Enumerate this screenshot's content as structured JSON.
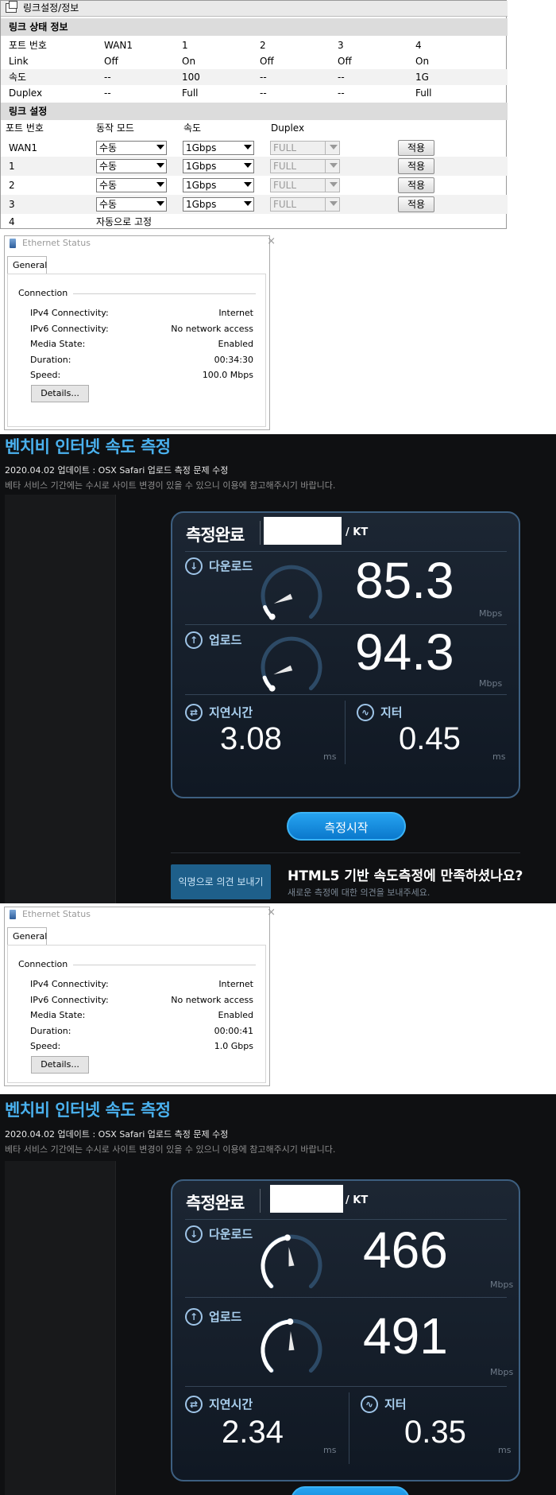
{
  "router": {
    "title": "링크설정/정보",
    "status_section": "링크 상태 정보",
    "status_header": [
      "포트 번호",
      "WAN1",
      "1",
      "2",
      "3",
      "4"
    ],
    "status_rows": [
      [
        "Link",
        "Off",
        "On",
        "Off",
        "Off",
        "On"
      ],
      [
        "속도",
        "--",
        "100",
        "--",
        "--",
        "1G"
      ],
      [
        "Duplex",
        "--",
        "Full",
        "--",
        "--",
        "Full"
      ]
    ],
    "settings_section": "링크 설정",
    "settings_header": [
      "포트 번호",
      "동작 모드",
      "속도",
      "Duplex"
    ],
    "settings_rows": [
      {
        "port": "WAN1",
        "mode": "수동",
        "speed": "1Gbps",
        "duplex": "FULL",
        "apply": "적용"
      },
      {
        "port": "1",
        "mode": "수동",
        "speed": "1Gbps",
        "duplex": "FULL",
        "apply": "적용"
      },
      {
        "port": "2",
        "mode": "수동",
        "speed": "1Gbps",
        "duplex": "FULL",
        "apply": "적용"
      },
      {
        "port": "3",
        "mode": "수동",
        "speed": "1Gbps",
        "duplex": "FULL",
        "apply": "적용"
      }
    ],
    "last_row": {
      "port": "4",
      "mode": "자동으로 고정"
    }
  },
  "eth1": {
    "title": "Ethernet Status",
    "tab": "General",
    "group": "Connection",
    "rows": [
      {
        "label": "IPv4 Connectivity:",
        "value": "Internet"
      },
      {
        "label": "IPv6 Connectivity:",
        "value": "No network access"
      },
      {
        "label": "Media State:",
        "value": "Enabled"
      },
      {
        "label": "Duration:",
        "value": "00:34:30"
      },
      {
        "label": "Speed:",
        "value": "100.0 Mbps"
      }
    ],
    "details": "Details..."
  },
  "speed1": {
    "title": "벤치비 인터넷 속도 측정",
    "update": "2020.04.02 업데이트 : OSX Safari 업로드 측정 문제 수정",
    "note": "베타 서비스 기간에는 수시로 사이트 변경이 있을 수 있으니 이용에 참고해주시기 바랍니다.",
    "status": "측정완료",
    "isp": "/ KT",
    "download_label": "다운로드",
    "download": "85.3",
    "download_fraction": 0.085,
    "upload_label": "업로드",
    "upload": "94.3",
    "upload_fraction": 0.094,
    "unit_speed": "Mbps",
    "latency_label": "지연시간",
    "latency": "3.08",
    "jitter_label": "지터",
    "jitter": "0.45",
    "unit_ms": "ms",
    "start_button": "측정시작",
    "feedback_button": "익명으로 의견 보내기",
    "question": "HTML5 기반 속도측정에 만족하셨나요?",
    "question_sub": "새로운 측정에 대한 의견을 보내주세요."
  },
  "eth2": {
    "title": "Ethernet Status",
    "tab": "General",
    "group": "Connection",
    "rows": [
      {
        "label": "IPv4 Connectivity:",
        "value": "Internet"
      },
      {
        "label": "IPv6 Connectivity:",
        "value": "No network access"
      },
      {
        "label": "Media State:",
        "value": "Enabled"
      },
      {
        "label": "Duration:",
        "value": "00:00:41"
      },
      {
        "label": "Speed:",
        "value": "1.0 Gbps"
      }
    ],
    "details": "Details..."
  },
  "speed2": {
    "title": "벤치비 인터넷 속도 측정",
    "update": "2020.04.02 업데이트 : OSX Safari 업로드 측정 문제 수정",
    "note": "베타 서비스 기간에는 수시로 사이트 변경이 있을 수 있으니 이용에 참고해주시기 바랍니다.",
    "status": "측정완료",
    "isp": "/ KT",
    "download_label": "다운로드",
    "download": "466",
    "download_fraction": 0.47,
    "upload_label": "업로드",
    "upload": "491",
    "upload_fraction": 0.49,
    "unit_speed": "Mbps",
    "latency_label": "지연시간",
    "latency": "2.34",
    "jitter_label": "지터",
    "jitter": "0.35",
    "unit_ms": "ms"
  },
  "colors": {
    "accent": "#4ab1ee",
    "gauge_track": "#2d4a66",
    "gauge_fill": "#3a6e9b"
  }
}
